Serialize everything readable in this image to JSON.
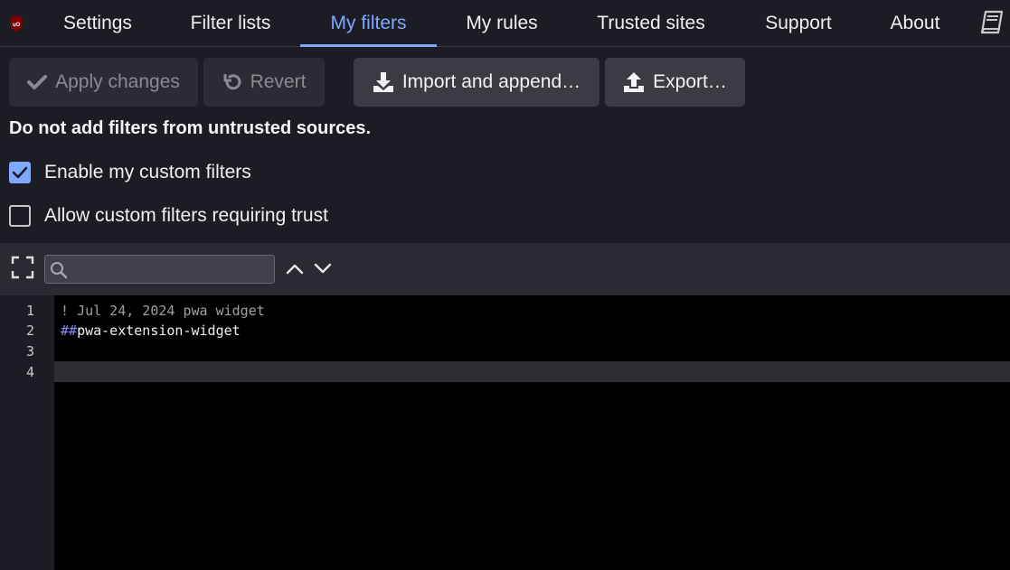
{
  "nav": {
    "tabs": [
      {
        "label": "Settings"
      },
      {
        "label": "Filter lists"
      },
      {
        "label": "My filters",
        "active": true
      },
      {
        "label": "My rules"
      },
      {
        "label": "Trusted sites"
      },
      {
        "label": "Support"
      },
      {
        "label": "About"
      }
    ],
    "logo_icon": "ublock-origin-logo",
    "docs_icon": "book-icon"
  },
  "toolbar": {
    "apply_label": "Apply changes",
    "apply_disabled": true,
    "revert_label": "Revert",
    "revert_disabled": true,
    "import_label": "Import and append…",
    "export_label": "Export…"
  },
  "warning_text": "Do not add filters from untrusted sources.",
  "options": {
    "enable_custom_label": "Enable my custom filters",
    "enable_custom_checked": true,
    "allow_trust_label": "Allow custom filters requiring trust",
    "allow_trust_checked": false
  },
  "editor": {
    "search_placeholder": "",
    "lines": [
      {
        "number": "1",
        "comment": "! Jul 24, 2024 pwa widget"
      },
      {
        "number": "2",
        "hash": "##",
        "text": "pwa-extension-widget"
      },
      {
        "number": "3",
        "text": ""
      },
      {
        "number": "4",
        "text": ""
      }
    ]
  },
  "colors": {
    "accent": "#7fa8ff",
    "background": "#1c1c24",
    "editor_background": "#000000"
  }
}
